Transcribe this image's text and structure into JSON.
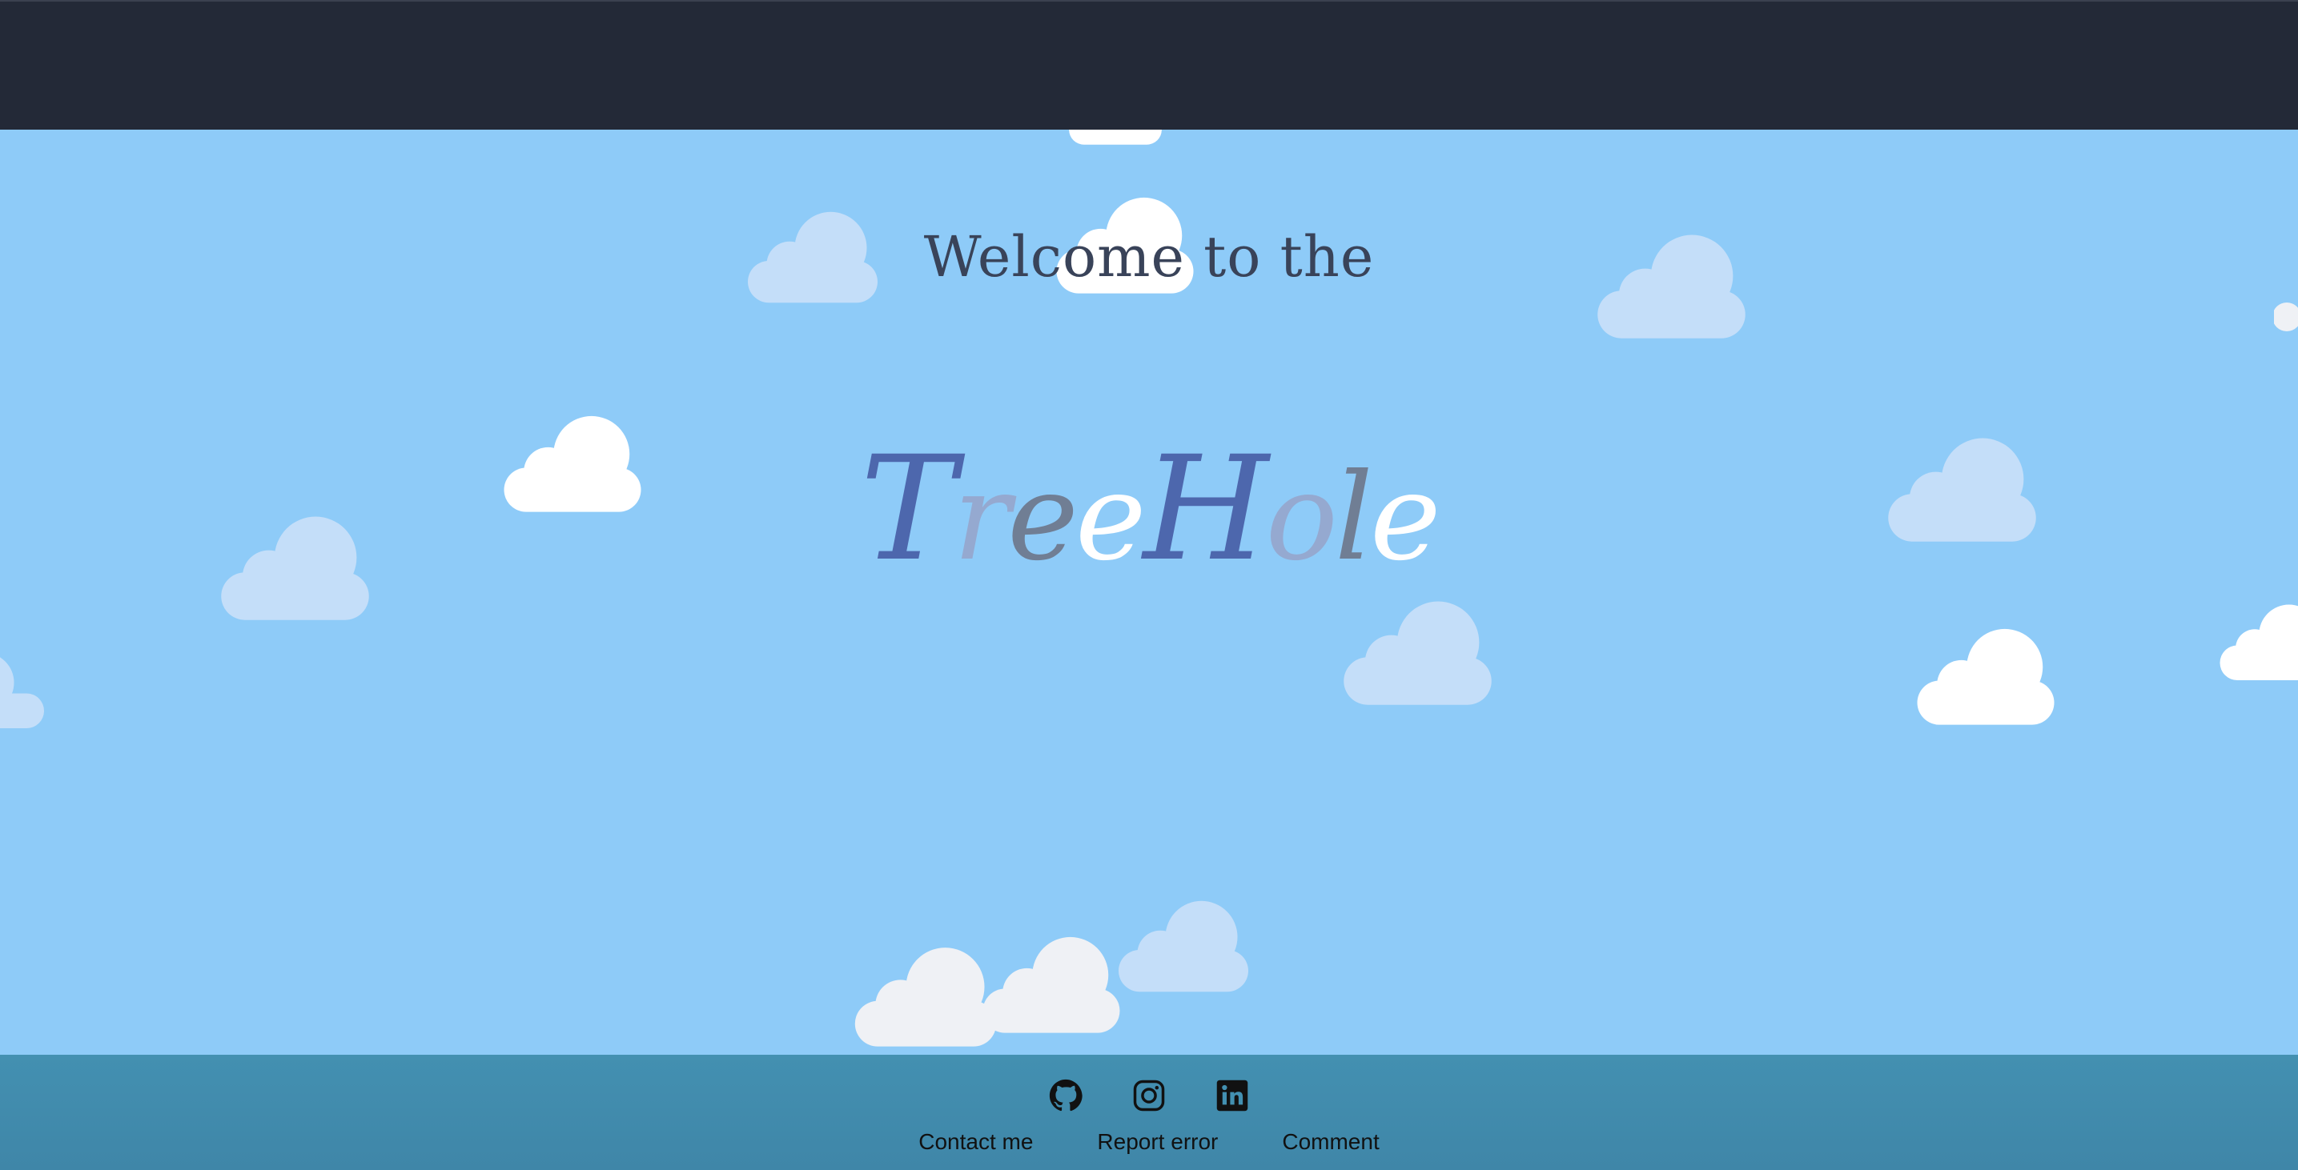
{
  "hero": {
    "welcome_text": "Welcome to the",
    "logo_letters": [
      {
        "char": "T",
        "color": "#4d67ad",
        "cap": true
      },
      {
        "char": "r",
        "color": "#95a9d0",
        "cap": false
      },
      {
        "char": "e",
        "color": "#707e94",
        "cap": false
      },
      {
        "char": "e",
        "color": "#ffffff",
        "cap": false
      },
      {
        "char": "H",
        "color": "#4d67ad",
        "cap": true
      },
      {
        "char": "o",
        "color": "#95a9d0",
        "cap": false
      },
      {
        "char": "l",
        "color": "#707e94",
        "cap": false
      },
      {
        "char": "e",
        "color": "#ffffff",
        "cap": false
      }
    ]
  },
  "footer": {
    "icons": [
      {
        "name": "github-icon"
      },
      {
        "name": "instagram-icon"
      },
      {
        "name": "linkedin-icon"
      }
    ],
    "links": {
      "contact": "Contact me",
      "report": "Report error",
      "comment": "Comment"
    }
  },
  "colors": {
    "sky": "#8ecbf8",
    "topbar": "#232937",
    "footer": "#4390b1",
    "cloud_white": "#ffffff",
    "cloud_light": "#c4def9",
    "cloud_grey": "#eff1f5"
  }
}
